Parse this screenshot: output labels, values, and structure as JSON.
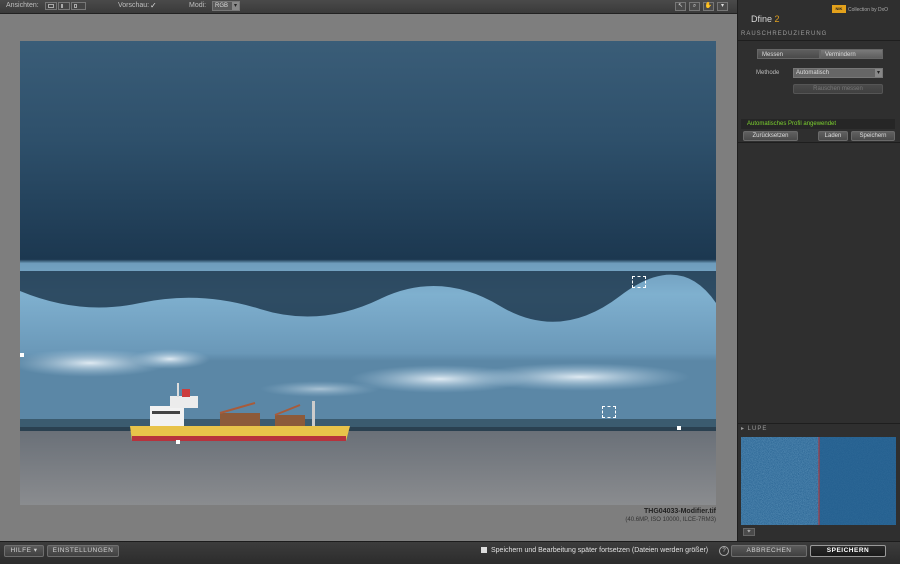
{
  "toolbar": {
    "views_label": "Ansichten:",
    "preview_label": "Vorschau:",
    "preview_check": "✓",
    "mode_label": "Modi:",
    "mode_value": "RGB",
    "tools": [
      "↖",
      "⌕",
      "✋",
      "▾"
    ]
  },
  "image": {
    "filename": "THG04033-Modifier.tif",
    "meta": "(40.6MP, ISO 10000, ILCE-7RM3)"
  },
  "panel": {
    "app_name": "Dfine",
    "app_version": "2",
    "brand_logo": "NIK",
    "brand_text": "Collection by DxO",
    "section_noise": "RAUSCHREDUZIERUNG",
    "tabs": {
      "measure": "Messen",
      "reduce": "Vermindern"
    },
    "method_label": "Methode",
    "method_value": "Automatisch",
    "measure_noise_button": "Rauschen messen",
    "status": "Automatisches Profil angewendet",
    "reset_button": "Zurücksetzen",
    "load_button": "Laden",
    "save_button": "Speichern",
    "section_loupe": "▸ LUPE"
  },
  "bottom": {
    "help_button": "HILFE ▾",
    "settings_button": "EINSTELLUNGEN",
    "save_later_label": "Speichern und Bearbeitung später fortsetzen (Dateien werden größer)",
    "help_icon": "?",
    "cancel_button": "ABBRECHEN",
    "save_button": "SPEICHERN"
  },
  "colors": {
    "accent_orange": "#e0a020",
    "status_green": "#7cd12f",
    "sky_dark": "#1f3a52",
    "ship_yellow": "#e8c34a",
    "ship_red": "#b7323c"
  }
}
